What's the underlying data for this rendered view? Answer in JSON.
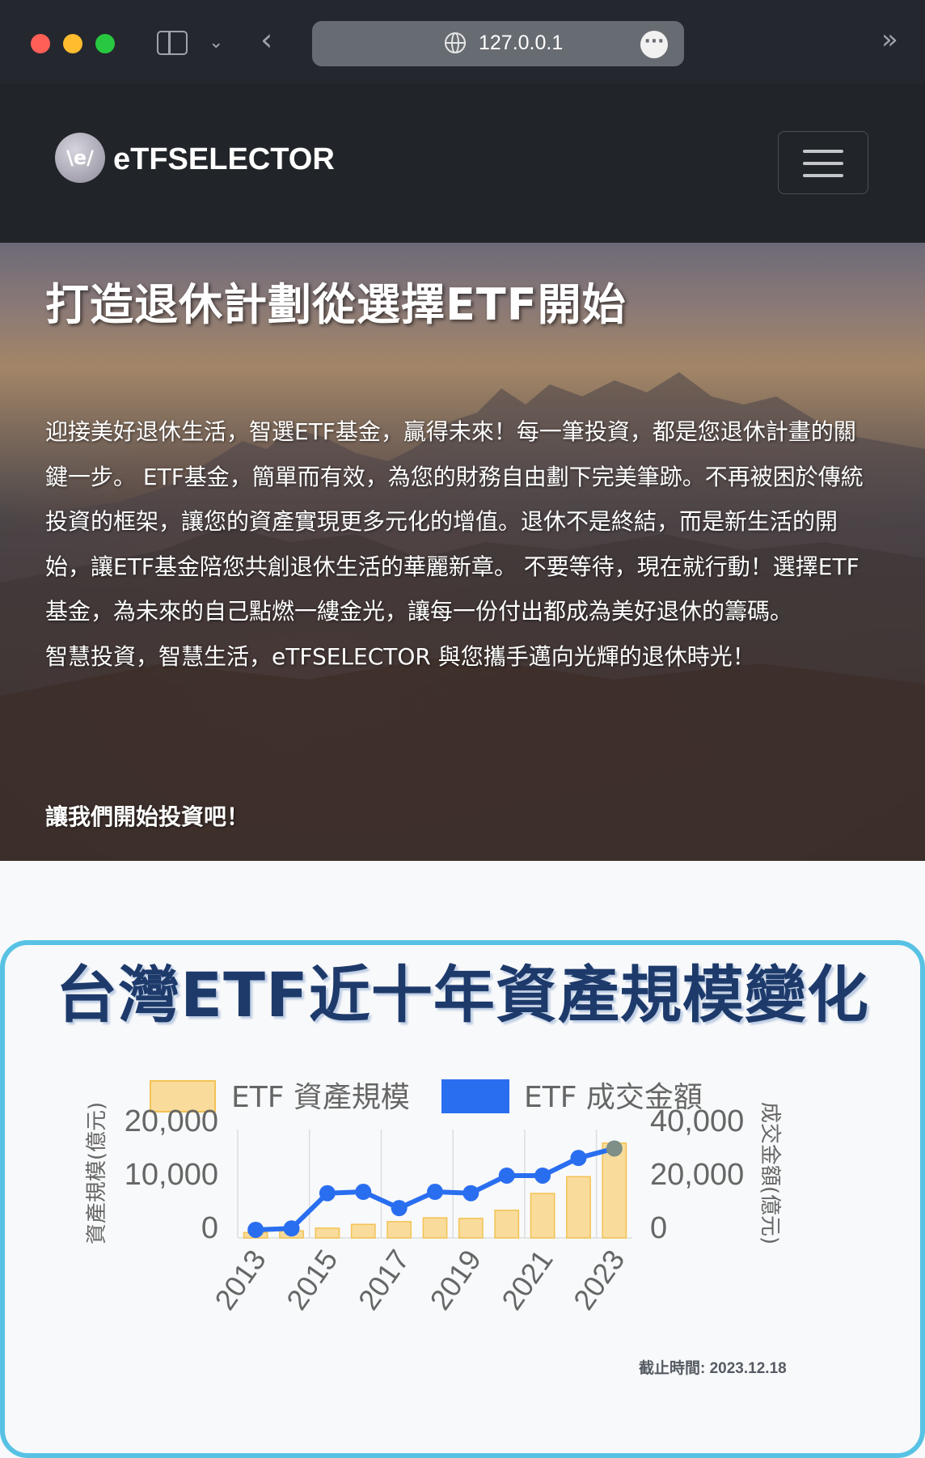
{
  "browser": {
    "url": "127.0.0.1",
    "icons": [
      "sidebar-icon",
      "chevron-down-icon",
      "back-icon",
      "globe-icon",
      "more-icon",
      "extensions-icon"
    ]
  },
  "navbar": {
    "brand": "eTFSELECTOR",
    "logo_text": "\\e/",
    "icons": [
      "logo-icon",
      "hamburger-menu-icon"
    ]
  },
  "hero": {
    "title": "打造退休計劃從選擇ETF開始",
    "paragraph": "迎接美好退休生活，智選ETF基金，贏得未來！每一筆投資，都是您退休計畫的關鍵一步。 ETF基金，簡單而有效，為您的財務自由劃下完美筆跡。不再被困於傳統投資的框架，讓您的資產實現更多元化的增值。退休不是終結，而是新生活的開始，讓ETF基金陪您共創退休生活的華麗新章。 不要等待，現在就行動！選擇ETF基金，為未來的自己點燃一縷金光，讓每一份付出都成為美好退休的籌碼。",
    "tagline": "智慧投資，智慧生活，eTFSELECTOR 與您攜手邁向光輝的退休時光！",
    "cta": "讓我們開始投資吧！"
  },
  "chart_card": {
    "title": "台灣ETF近十年資產規模變化",
    "footnote": "截止時間: 2023.12.18"
  },
  "chart_data": {
    "type": "bar",
    "x": [
      2013,
      2014,
      2015,
      2016,
      2017,
      2018,
      2019,
      2020,
      2021,
      2022,
      2023
    ],
    "x_tick_labels": [
      "2013",
      "2015",
      "2017",
      "2019",
      "2021",
      "2023"
    ],
    "series": [
      {
        "name": "ETF 資產規模",
        "type": "bar",
        "axis": "left",
        "color": "#f9dc9b",
        "border": "#f2c254",
        "values": [
          1000,
          1300,
          1800,
          2500,
          3000,
          3700,
          3600,
          5100,
          8200,
          11300,
          17500
        ]
      },
      {
        "name": "ETF 成交金額",
        "type": "line",
        "axis": "right",
        "color": "#2a6ef0",
        "values": [
          3000,
          3500,
          16500,
          17000,
          11000,
          17000,
          16500,
          23000,
          23000,
          29500,
          33000
        ]
      }
    ],
    "y_left": {
      "label": "資產規模(億元)",
      "ticks": [
        "0",
        "10,000",
        "20,000"
      ],
      "range": [
        0,
        20000
      ]
    },
    "y_right": {
      "label": "成交金額(億元)",
      "ticks": [
        "0",
        "20,000",
        "40,000"
      ],
      "range": [
        0,
        40000
      ]
    },
    "legend_position": "top",
    "grid": "vertical"
  }
}
